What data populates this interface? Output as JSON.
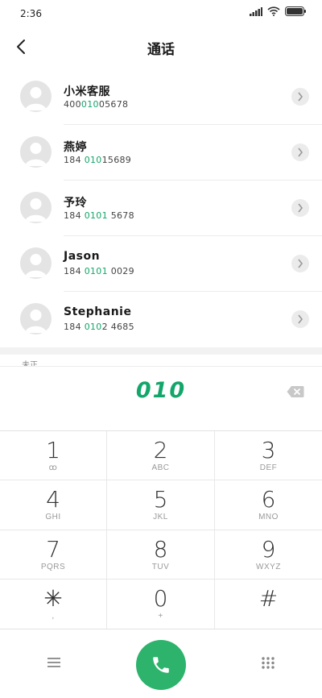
{
  "status": {
    "time": "2:36"
  },
  "header": {
    "title": "通话"
  },
  "contacts": [
    {
      "name": "小米客服",
      "number_pre": "400",
      "number_hl": "010",
      "number_post": "05678"
    },
    {
      "name": "燕婷",
      "number_pre": "184 ",
      "number_hl": "010",
      "number_post": "15689"
    },
    {
      "name": "予玲",
      "number_pre": "184 ",
      "number_hl": "0101",
      "number_post": " 5678"
    },
    {
      "name": "Jason",
      "number_pre": "184 ",
      "number_hl": "0101",
      "number_post": " 0029"
    },
    {
      "name": "Stephanie",
      "number_pre": "184 ",
      "number_hl": "010",
      "number_post": "2 4685"
    }
  ],
  "section_partial_label": "未正",
  "dial": {
    "digits": "010"
  },
  "keypad": [
    {
      "num": "1",
      "sub": "ꝏ"
    },
    {
      "num": "2",
      "sub": "ABC"
    },
    {
      "num": "3",
      "sub": "DEF"
    },
    {
      "num": "4",
      "sub": "GHI"
    },
    {
      "num": "5",
      "sub": "JKL"
    },
    {
      "num": "6",
      "sub": "MNO"
    },
    {
      "num": "7",
      "sub": "PQRS"
    },
    {
      "num": "8",
      "sub": "TUV"
    },
    {
      "num": "9",
      "sub": "WXYZ"
    },
    {
      "num": "✳",
      "sub": ","
    },
    {
      "num": "0",
      "sub": "+"
    },
    {
      "num": "#",
      "sub": ""
    }
  ],
  "colors": {
    "accent": "#13a66a",
    "call_button": "#2db36c"
  },
  "icons": {
    "back": "chevron-left-icon",
    "backspace": "backspace-icon",
    "menu": "menu-icon",
    "call": "phone-icon",
    "keypad": "dialpad-icon"
  }
}
